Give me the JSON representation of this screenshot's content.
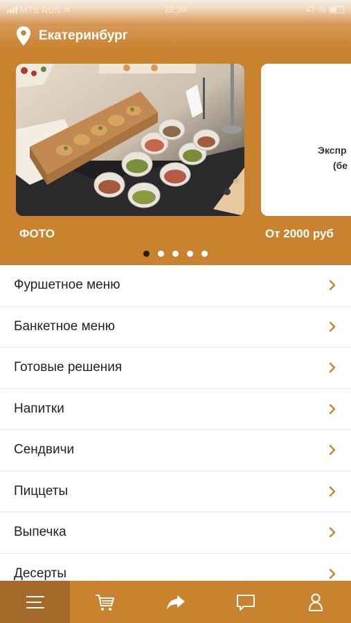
{
  "status_bar": {
    "carrier": "MTS RUS",
    "time": "22:39",
    "battery": "47 %"
  },
  "location": {
    "city": "Екатеринбург",
    "icon": "location-pin-icon"
  },
  "carousel": {
    "active_index": 0,
    "slides": [
      {
        "caption": "ФОТО"
      },
      {
        "caption": "От 2000 руб",
        "card_text_1": "Экспр",
        "card_text_2": "(бе"
      }
    ],
    "dot_count": 5
  },
  "menu": {
    "items": [
      {
        "label": "Фуршетное меню"
      },
      {
        "label": "Банкетное меню"
      },
      {
        "label": "Готовые решения"
      },
      {
        "label": "Напитки"
      },
      {
        "label": "Сендвичи"
      },
      {
        "label": "Пиццеты"
      },
      {
        "label": "Выпечка"
      },
      {
        "label": "Десерты"
      }
    ]
  },
  "tabbar": {
    "tabs": [
      {
        "icon": "menu-icon",
        "active": true
      },
      {
        "icon": "cart-icon",
        "active": false
      },
      {
        "icon": "share-icon",
        "active": false
      },
      {
        "icon": "chat-icon",
        "active": false
      },
      {
        "icon": "profile-icon",
        "active": false
      }
    ]
  },
  "colors": {
    "accent": "#c9832f",
    "accent_dark": "#a4692a",
    "text": "#222222"
  }
}
